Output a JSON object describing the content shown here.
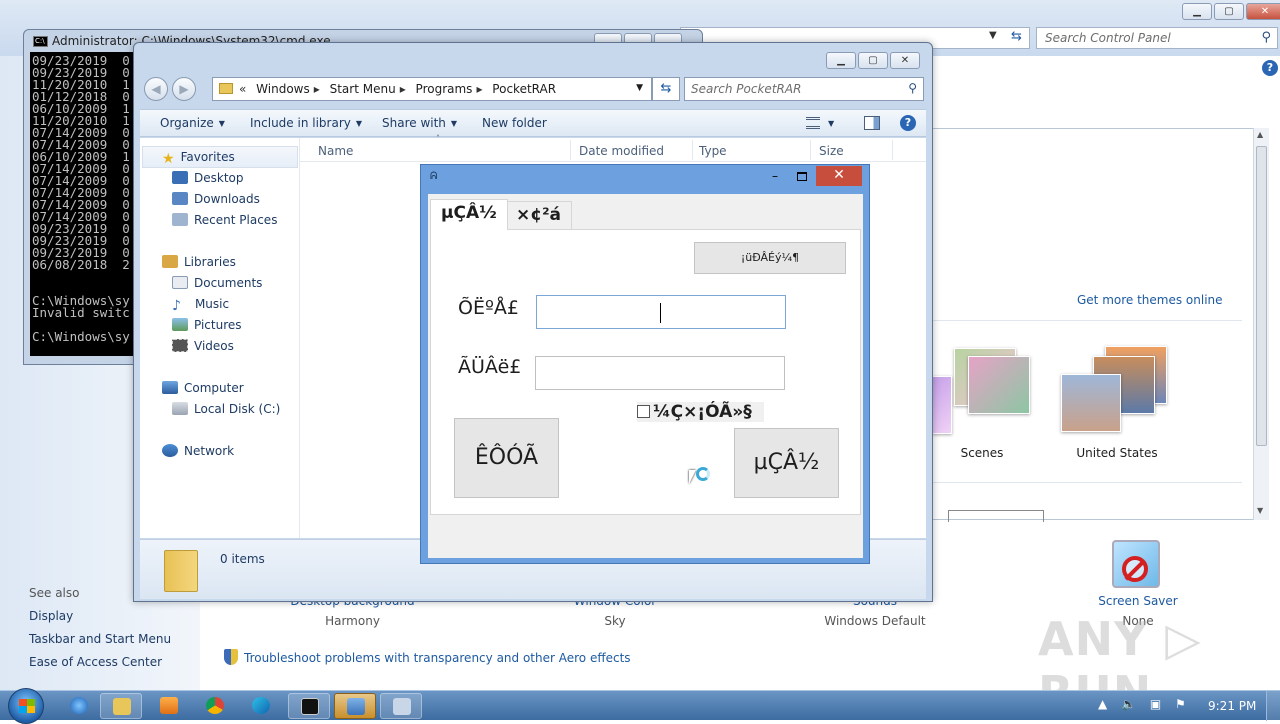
{
  "control_panel": {
    "search_placeholder": "Search Control Panel",
    "get_more_themes": "Get more themes online",
    "themes": [
      {
        "label": "Scenes"
      },
      {
        "label": "United States"
      }
    ],
    "bottom_items": [
      {
        "link": "Desktop background",
        "value": "Harmony"
      },
      {
        "link": "Window Color",
        "value": "Sky"
      },
      {
        "link": "Sounds",
        "value": "Windows Default"
      },
      {
        "link": "Screen Saver",
        "value": "None"
      }
    ],
    "see_also": {
      "heading": "See also",
      "links": [
        "Display",
        "Taskbar and Start Menu",
        "Ease of Access Center"
      ]
    },
    "troubleshoot_link": "Troubleshoot problems with transparency and other Aero effects"
  },
  "cmd": {
    "title": "Administrator: C:\\Windows\\System32\\cmd.exe",
    "lines": [
      "09/23/2019  0",
      "09/23/2019  0",
      "11/20/2010  1",
      "01/12/2018  0",
      "06/10/2009  1",
      "11/20/2010  1",
      "07/14/2009  0",
      "07/14/2009  0",
      "06/10/2009  1",
      "07/14/2009  0",
      "07/14/2009  0",
      "07/14/2009  0",
      "07/14/2009  0",
      "07/14/2009  0",
      "09/23/2019  0",
      "09/23/2019  0",
      "09/23/2019  0",
      "06/08/2018  2",
      "",
      "",
      "C:\\Windows\\sy",
      "Invalid switc",
      "",
      "C:\\Windows\\sy"
    ]
  },
  "explorer": {
    "breadcrumb": [
      "Windows",
      "Start Menu",
      "Programs",
      "PocketRAR"
    ],
    "search_placeholder": "Search PocketRAR",
    "toolbar": {
      "organize": "Organize",
      "include_in_library": "Include in library",
      "share_with": "Share with",
      "new_folder": "New folder"
    },
    "nav": {
      "favorites": "Favorites",
      "desktop": "Desktop",
      "downloads": "Downloads",
      "recent_places": "Recent Places",
      "libraries": "Libraries",
      "documents": "Documents",
      "music": "Music",
      "pictures": "Pictures",
      "videos": "Videos",
      "computer": "Computer",
      "local_disk": "Local Disk (C:)",
      "network": "Network"
    },
    "columns": [
      "Name",
      "Date modified",
      "Type",
      "Size"
    ],
    "items_count": "0 items"
  },
  "dialog": {
    "tabs": [
      "µÇÂ½",
      "×¢²á"
    ],
    "top_button": "¡üÐÂÉý¼¶",
    "field1_label": "ÕËºÅ£",
    "field2_label": "ÃÜÂë£",
    "checkbox_label": "¼Ç×¡ÓÃ»§",
    "left_button": "ÊÔÓÃ",
    "right_button": "µÇÂ½"
  },
  "taskbar": {
    "clock": "9:21 PM"
  },
  "watermark": "ANY RUN"
}
